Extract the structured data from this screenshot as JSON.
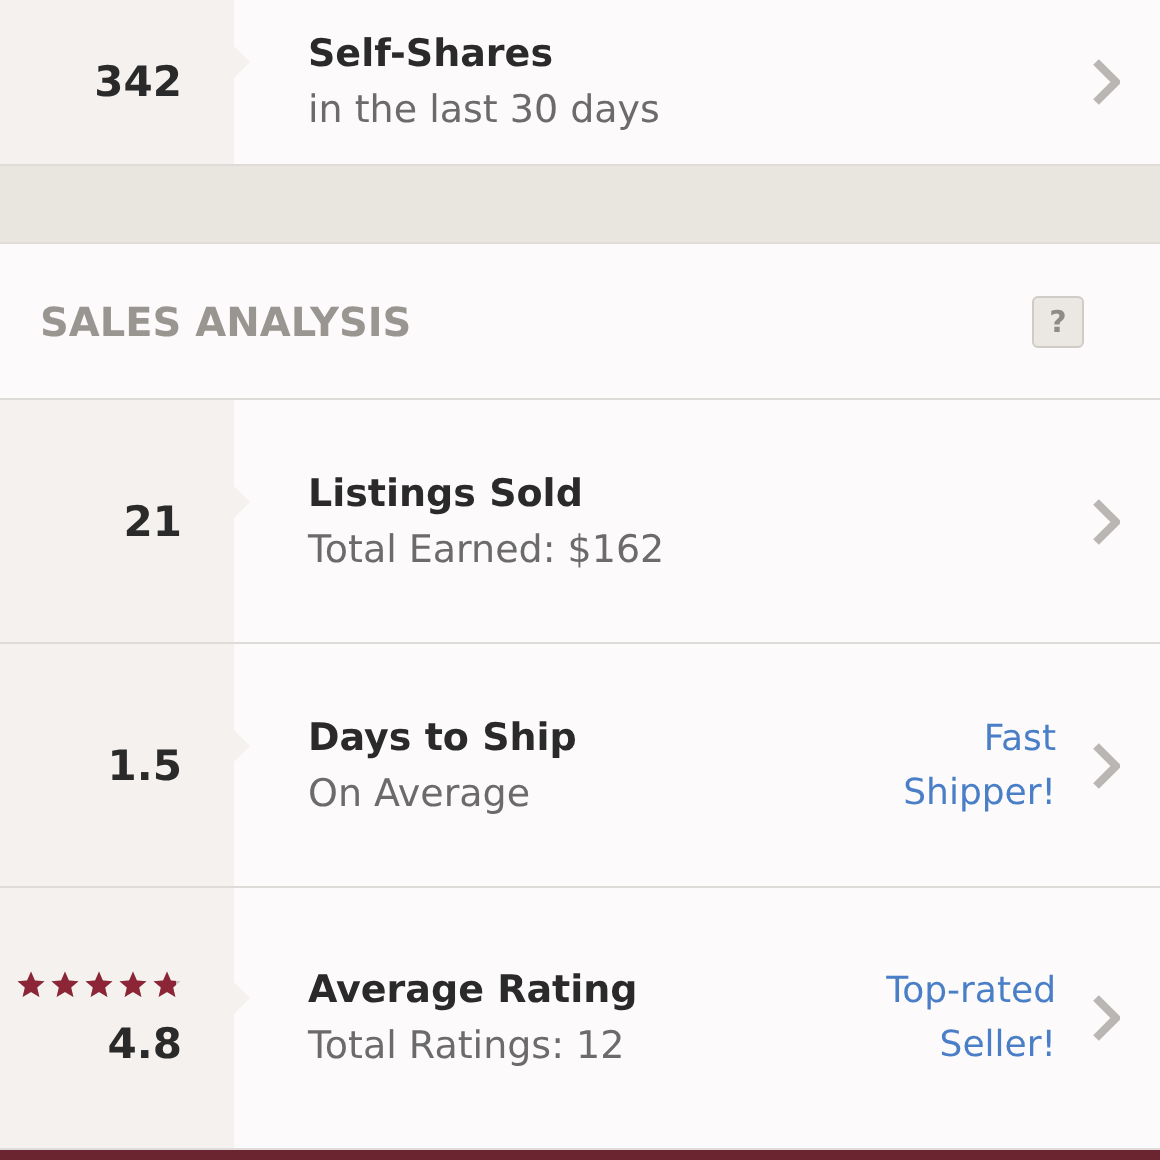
{
  "top_row": {
    "value": "342",
    "title": "Self-Shares",
    "subtitle": "in the last 30 days"
  },
  "section": {
    "title": "SALES ANALYSIS",
    "help": "?"
  },
  "rows": [
    {
      "kind": "plain",
      "value": "21",
      "title": "Listings Sold",
      "subtitle": "Total Earned: $162"
    },
    {
      "kind": "badge",
      "value": "1.5",
      "title": "Days to Ship",
      "subtitle": "On Average",
      "badge": "Fast Shipper!"
    },
    {
      "kind": "rating",
      "value": "4.8",
      "stars": 4.8,
      "title": "Average Rating",
      "subtitle": "Total Ratings: 12",
      "badge": "Top-rated Seller!"
    }
  ]
}
